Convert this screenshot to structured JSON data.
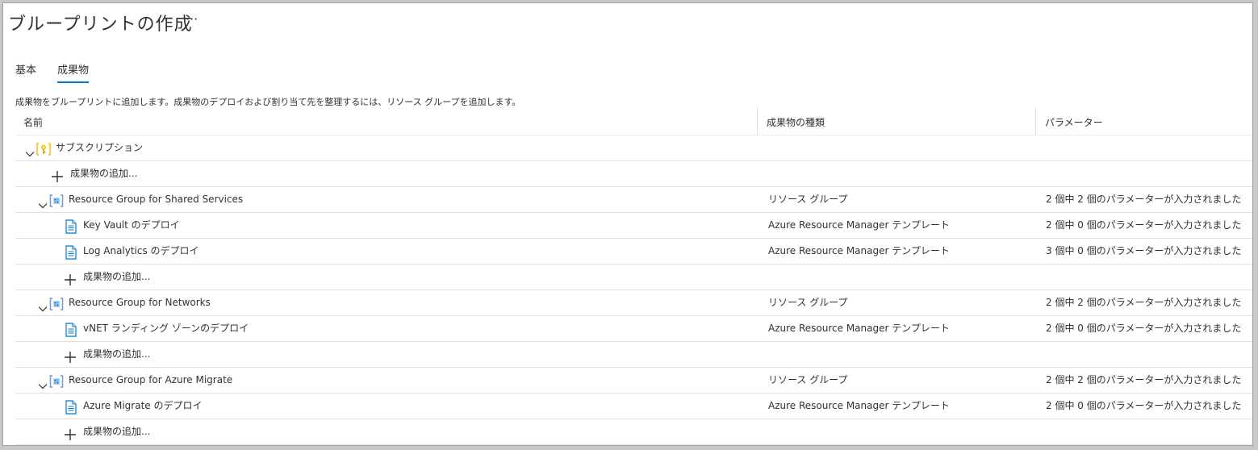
{
  "page": {
    "title": "ブループリントの作成",
    "more": "···",
    "description": "成果物をブループリントに追加します。成果物のデプロイおよび割り当て先を整理するには、リソース グループを追加します。"
  },
  "tabs": [
    {
      "label": "基本"
    },
    {
      "label": "成果物"
    }
  ],
  "columns": {
    "name": "名前",
    "type": "成果物の種類",
    "params": "パラメーター"
  },
  "rows": [
    {
      "kind": "subscription",
      "name": "サブスクリプション",
      "type": "",
      "params": "",
      "icon": "subscription-key-icon"
    },
    {
      "kind": "add",
      "name": "成果物の追加...",
      "type": "",
      "params": "",
      "icon": "plus-icon"
    },
    {
      "kind": "rg",
      "name": "Resource Group for Shared Services",
      "type": "リソース グループ",
      "params": "2 個中 2 個のパラメーターが入力されました",
      "icon": "resource-group-icon"
    },
    {
      "kind": "artifact",
      "name": "Key Vault のデプロイ",
      "type": "Azure Resource Manager テンプレート",
      "params": "2 個中 0 個のパラメーターが入力されました",
      "icon": "template-icon"
    },
    {
      "kind": "artifact",
      "name": "Log Analytics のデプロイ",
      "type": "Azure Resource Manager テンプレート",
      "params": "3 個中 0 個のパラメーターが入力されました",
      "icon": "template-icon"
    },
    {
      "kind": "add-sub",
      "name": "成果物の追加...",
      "type": "",
      "params": "",
      "icon": "plus-icon"
    },
    {
      "kind": "rg",
      "name": "Resource Group for Networks",
      "type": "リソース グループ",
      "params": "2 個中 2 個のパラメーターが入力されました",
      "icon": "resource-group-icon"
    },
    {
      "kind": "artifact",
      "name": "vNET ランディング ゾーンのデプロイ",
      "type": "Azure Resource Manager テンプレート",
      "params": "2 個中 0 個のパラメーターが入力されました",
      "icon": "template-icon"
    },
    {
      "kind": "add-sub",
      "name": "成果物の追加...",
      "type": "",
      "params": "",
      "icon": "plus-icon"
    },
    {
      "kind": "rg",
      "name": "Resource Group for Azure Migrate",
      "type": "リソース グループ",
      "params": "2 個中 2 個のパラメーターが入力されました",
      "icon": "resource-group-icon"
    },
    {
      "kind": "artifact",
      "name": "Azure Migrate のデプロイ",
      "type": "Azure Resource Manager テンプレート",
      "params": "2 個中 0 個のパラメーターが入力されました",
      "icon": "template-icon"
    },
    {
      "kind": "add-sub",
      "name": "成果物の追加...",
      "type": "",
      "params": "",
      "icon": "plus-icon"
    }
  ],
  "colors": {
    "accent": "#0078d4",
    "subscription_icon": "#f2c811",
    "text": "#323130"
  }
}
